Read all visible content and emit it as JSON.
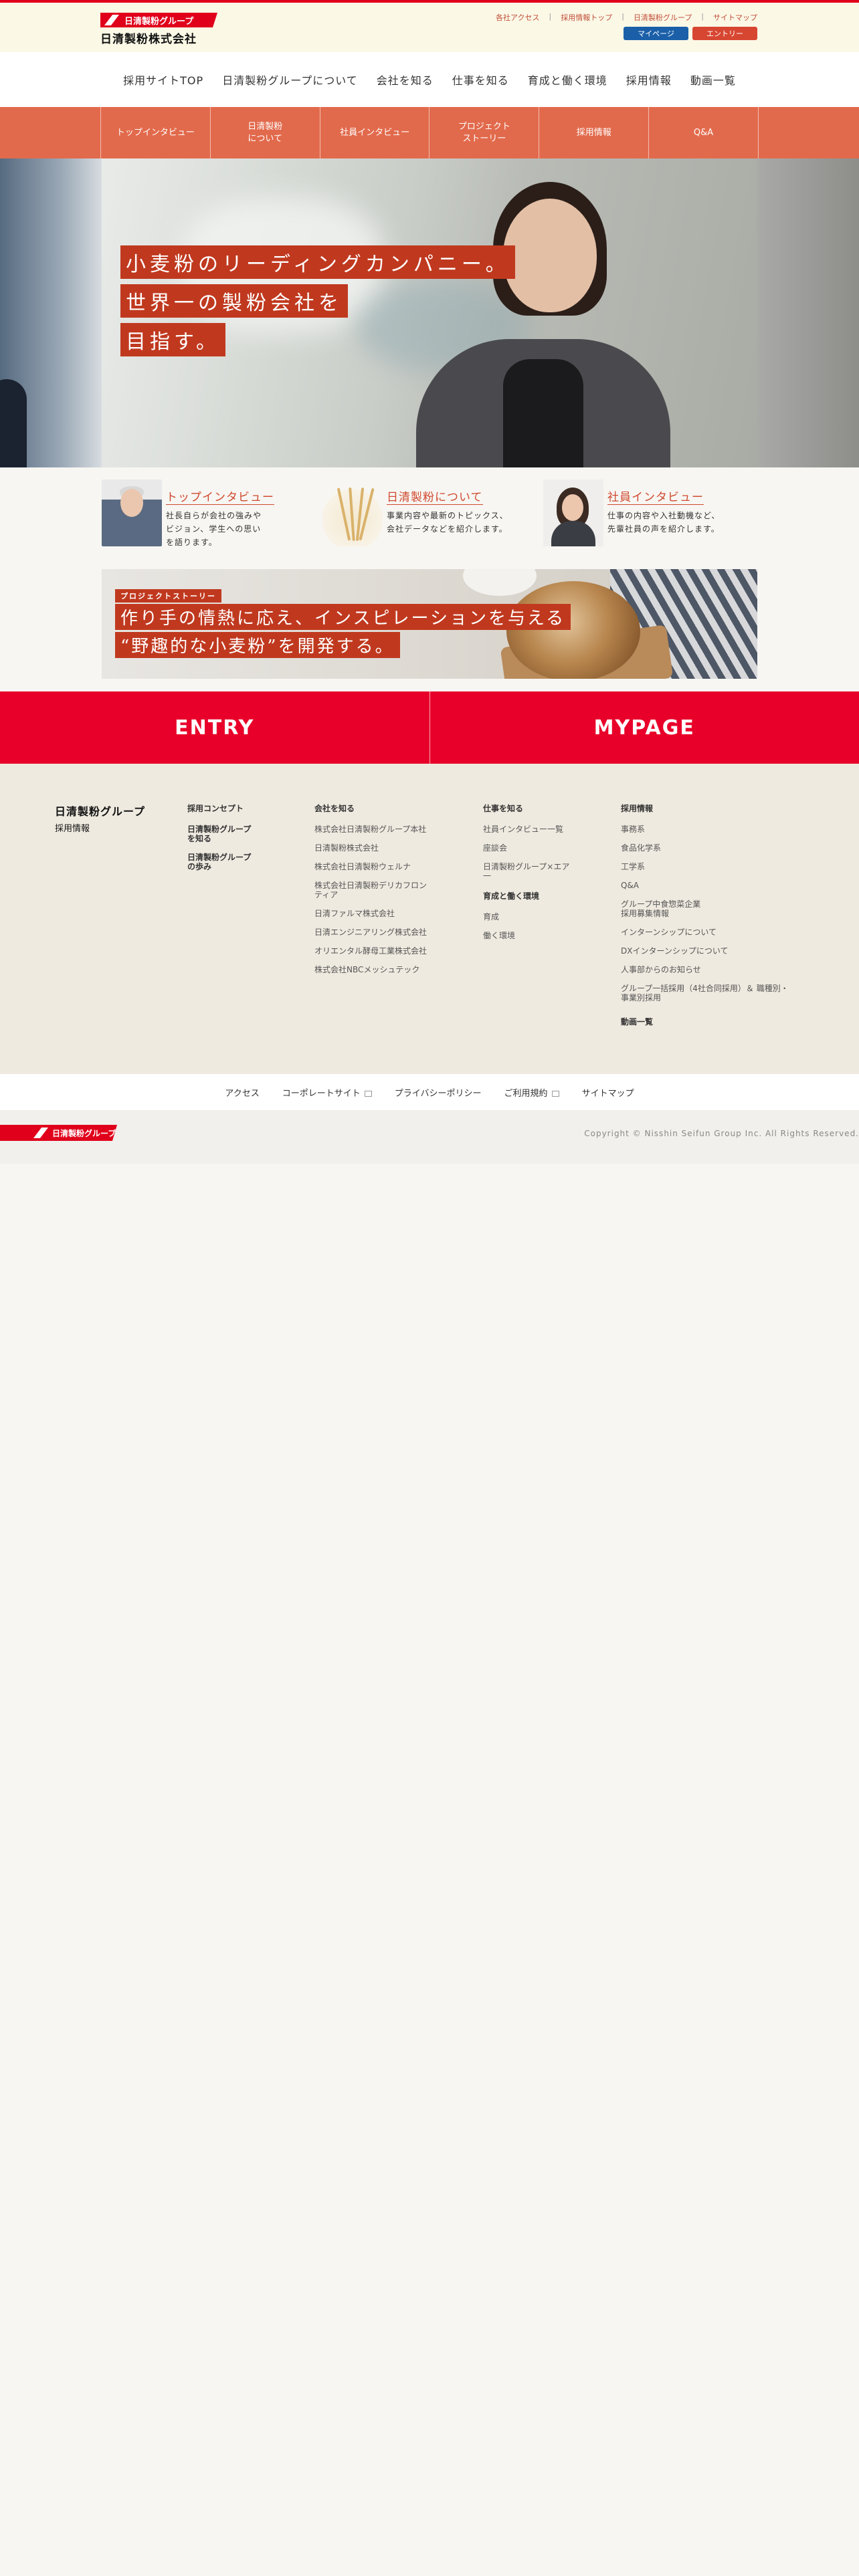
{
  "header": {
    "brand_mark": "日清製粉グループ",
    "company": "日清製粉株式会社",
    "util_links": [
      "各社アクセス",
      "採用情報トップ",
      "日清製粉グループ",
      "サイトマップ"
    ],
    "mypage_label": "マイページ",
    "entry_label": "エントリー"
  },
  "gnav": [
    "採用サイトTOP",
    "日清製粉グループについて",
    "会社を知る",
    "仕事を知る",
    "育成と働く環境",
    "採用情報",
    "動画一覧"
  ],
  "subnav": [
    "トップインタビュー",
    "日清製粉\nについて",
    "社員インタビュー",
    "プロジェクト\nストーリー",
    "採用情報",
    "Q&A"
  ],
  "hero": {
    "lines": [
      "小麦粉のリーディングカンパニー。",
      "世界一の製粉会社を",
      "目指す。"
    ]
  },
  "cards": [
    {
      "title": "トップインタビュー",
      "desc": "社長自らが会社の強みや\nビジョン、学生への思い\nを語ります。"
    },
    {
      "title": "日清製粉について",
      "desc": "事業内容や最新のトピックス、\n会社データなどを紹介します。"
    },
    {
      "title": "社員インタビュー",
      "desc": "仕事の内容や入社動機など、\n先輩社員の声を紹介します。"
    }
  ],
  "project": {
    "tag": "プロジェクトストーリー",
    "line1": "作り手の情熱に応え、インスピレーションを与える",
    "line2": "“野趣的な小麦粉”を開発する。"
  },
  "cta": {
    "entry": "ENTRY",
    "mypage": "MYPAGE"
  },
  "footer": {
    "logo_main": "日清製粉グループ",
    "logo_sub": "採用情報",
    "col1": [
      "採用コンセプト",
      "日清製粉グループ\nを知る",
      "日清製粉グループ\nの歩み"
    ],
    "col2_head": "会社を知る",
    "col2": [
      "株式会社日清製粉グループ本社",
      "日清製粉株式会社",
      "株式会社日清製粉ウェルナ",
      "株式会社日清製粉デリカフロンティア",
      "日清ファルマ株式会社",
      "日清エンジニアリング株式会社",
      "オリエンタル酵母工業株式会社",
      "株式会社NBCメッシュテック"
    ],
    "col3_head": "仕事を知る",
    "col3": [
      "社員インタビュー一覧",
      "座談会",
      "日清製粉グループ×エア一"
    ],
    "col3b_head": "育成と働く環境",
    "col3b": [
      "育成",
      "働く環境"
    ],
    "col4_head": "採用情報",
    "col4": [
      "事務系",
      "食品化学系",
      "工学系",
      "Q&A",
      "グループ中食惣菜企業\n採用募集情報",
      "インターンシップについて",
      "DXインターンシップについて",
      "人事部からのお知らせ",
      "グループ一括採用（4社合同採用）＆ 職種別・\n事業別採用"
    ],
    "col4_foot": "動画一覧"
  },
  "footer_bar": [
    "アクセス",
    "コーポレートサイト",
    "プライバシーポリシー",
    "ご利用規約",
    "サイトマップ"
  ],
  "copyright": "Copyright © Nisshin Seifun Group Inc. All Rights Reserved."
}
